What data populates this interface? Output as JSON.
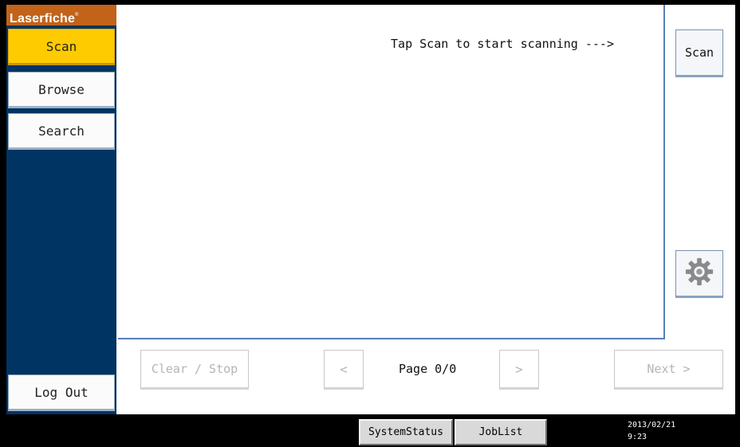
{
  "sidebar": {
    "brand": "Laserfiche",
    "brand_mark": "®",
    "items": [
      {
        "label": "Scan",
        "active": true
      },
      {
        "label": "Browse",
        "active": false
      },
      {
        "label": "Search",
        "active": false
      }
    ],
    "logout_label": "Log Out"
  },
  "main": {
    "hint": "Tap Scan to start scanning --->"
  },
  "right_panel": {
    "scan_label": "Scan",
    "settings_icon": "gear-icon"
  },
  "controls": {
    "clear_label": "Clear / Stop",
    "prev_label": "<",
    "page_label": "Page 0/0",
    "next_page_label": ">",
    "next_label": "Next >"
  },
  "statusbar": {
    "system_status_label": "SystemStatus",
    "job_list_label": "JobList",
    "date": "2013/02/21",
    "time": "9:23"
  },
  "colors": {
    "sidebar_bg": "#003462",
    "brand_bg": "#c2631a",
    "active_item": "#fecb00",
    "panel_border": "#5580b5"
  }
}
